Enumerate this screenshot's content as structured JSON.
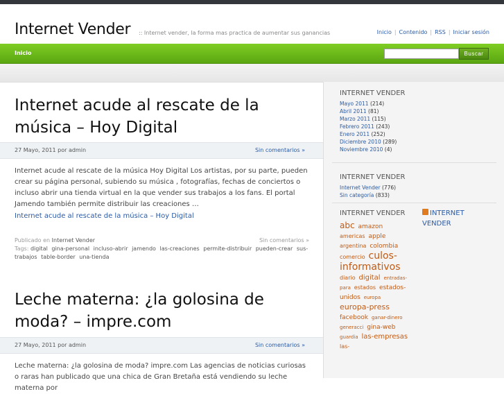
{
  "site": {
    "title": "Internet Vender",
    "tagline": ":: Internet vender, la forma mas practica de aumentar sus ganancias",
    "toplinks": [
      "Inicio",
      "Contenido",
      "RSS",
      "Iniciar sesión"
    ]
  },
  "nav": {
    "home": "Inicio",
    "search_button": "Buscar",
    "search_value": ""
  },
  "posts": [
    {
      "title_line1": "Internet acude al rescate de la",
      "title_line2": "música – Hoy Digital",
      "date": "27 Mayo, 2011 por admin",
      "comments": "Sin comentarios »",
      "excerpt": "Internet acude al rescate de la música Hoy Digital Los artistas, por su parte, pueden crear su página personal, subiendo su música , fotografías, fechas de conciertos o incluso abrir una tienda virtual en la que vender sus trabajos a los fans. El portal Jamendo también permite distribuir las creaciones …",
      "link": "Internet acude al rescate de la música – Hoy Digital",
      "published_label": "Publicado en",
      "category": "Internet Vender",
      "foot_comments": "Sin comentarios »",
      "tags_label": "Tags:",
      "tags": [
        "digital",
        "gina-personal",
        "incluso-abrir",
        "jamendo",
        "las-creaciones",
        "permite-distribuir",
        "pueden-crear",
        "sus-trabajos",
        "table-border",
        "una-tienda"
      ]
    },
    {
      "title_line1": "Leche materna: ¿la golosina de",
      "title_line2": "moda? – impre.com",
      "date": "27 Mayo, 2011 por admin",
      "comments": "Sin comentarios »",
      "excerpt": "Leche materna: ¿la golosina de moda? impre.com Las agencias de noticias curiosas o raras han publicado que una chica de Gran Bretaña está vendiendo su leche materna por"
    }
  ],
  "sidebar": {
    "archive_title": "INTERNET VENDER",
    "archives": [
      {
        "label": "Mayo 2011",
        "count": "(214)"
      },
      {
        "label": "Abril 2011",
        "count": "(81)"
      },
      {
        "label": "Marzo 2011",
        "count": "(115)"
      },
      {
        "label": "Febrero 2011",
        "count": "(243)"
      },
      {
        "label": "Enero 2011",
        "count": "(252)"
      },
      {
        "label": "Diciembre 2010",
        "count": "(289)"
      },
      {
        "label": "Noviembre 2010",
        "count": "(4)"
      }
    ],
    "categories_title": "INTERNET VENDER",
    "categories": [
      {
        "label": "Internet Vender",
        "count": "(776)"
      },
      {
        "label": "Sin categoría",
        "count": "(833)"
      }
    ],
    "tags_title": "INTERNET VENDER",
    "rss_label": "INTERNET VENDER",
    "tagcloud": [
      {
        "text": "abc",
        "size": 12
      },
      {
        "text": "amazon",
        "size": 9
      },
      {
        "text": "americas",
        "size": 8
      },
      {
        "text": "apple",
        "size": 9
      },
      {
        "text": "argentina",
        "size": 8
      },
      {
        "text": "colombia",
        "size": 9
      },
      {
        "text": "comercio",
        "size": 8
      },
      {
        "text": "culos-informativos",
        "size": 14
      },
      {
        "text": "diario",
        "size": 8
      },
      {
        "text": "digital",
        "size": 10
      },
      {
        "text": "entradas-para",
        "size": 7
      },
      {
        "text": "estados",
        "size": 8
      },
      {
        "text": "estados-unidos",
        "size": 9
      },
      {
        "text": "europa",
        "size": 7
      },
      {
        "text": "europa-press",
        "size": 11
      },
      {
        "text": "facebook",
        "size": 9
      },
      {
        "text": "ganar-dinero",
        "size": 7
      },
      {
        "text": "generacci",
        "size": 7
      },
      {
        "text": "gina-web",
        "size": 9
      },
      {
        "text": "guardia",
        "size": 7
      },
      {
        "text": "las-empresas",
        "size": 10
      },
      {
        "text": "las-",
        "size": 8
      }
    ]
  },
  "colors": {
    "accent_green": "#6cb81c",
    "link_blue": "#2a5aa5",
    "tag_orange": "#c25a12"
  }
}
